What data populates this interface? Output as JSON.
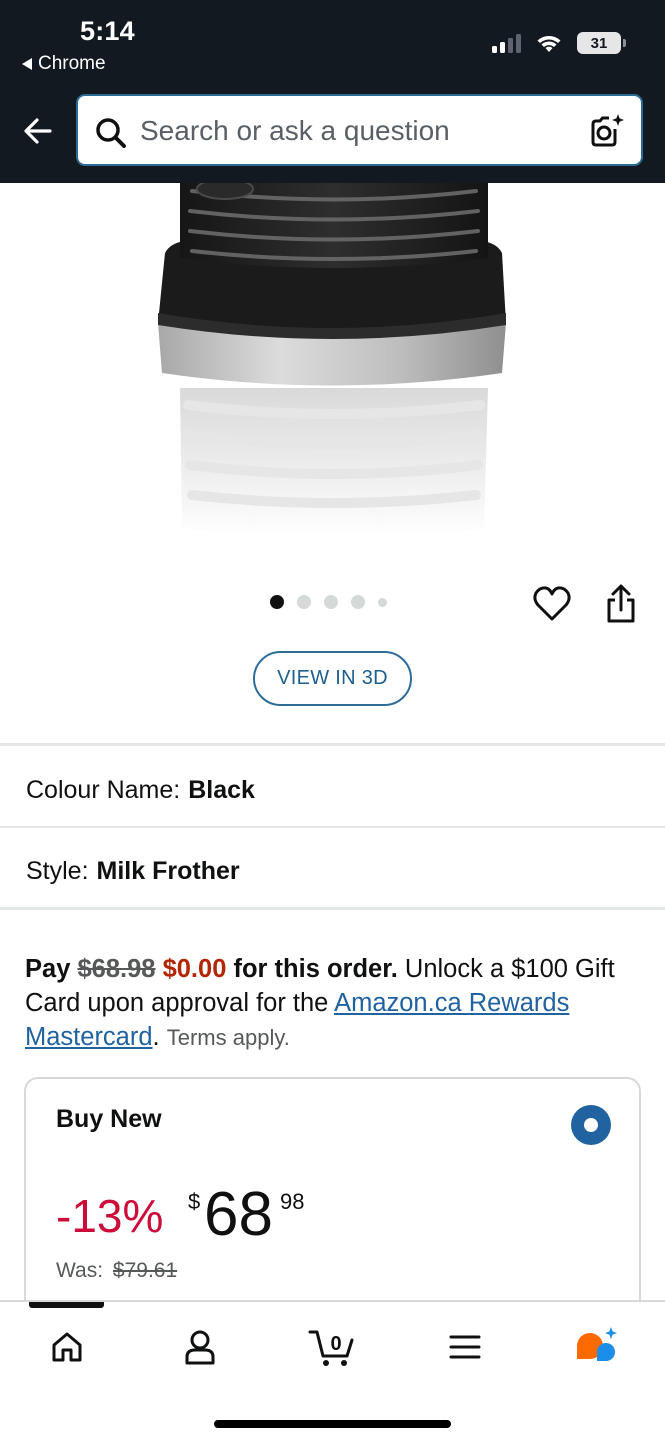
{
  "status_bar": {
    "time": "5:14",
    "back_app": "Chrome",
    "battery": "31"
  },
  "search": {
    "placeholder": "Search or ask a question"
  },
  "gallery": {
    "image_count": 5,
    "active_index": 0
  },
  "view_3d_label": "VIEW IN 3D",
  "colour": {
    "label": "Colour Name:",
    "value": "Black"
  },
  "style": {
    "label": "Style:",
    "value": "Milk Frother"
  },
  "offer": {
    "pay": "Pay",
    "old_price": "$68.98",
    "new_price": "$0.00",
    "for_order": "for this order.",
    "unlock_text": "Unlock a $100 Gift Card upon approval for the",
    "link_text": "Amazon.ca Rewards Mastercard",
    "period": ".",
    "terms": "Terms apply."
  },
  "buy_new": {
    "title": "Buy New",
    "discount": "-13%",
    "currency": "$",
    "price_whole": "68",
    "price_fraction": "98",
    "was_label": "Was:",
    "was_price": "$79.61"
  },
  "bottom_nav": {
    "cart_count": "0",
    "items": [
      "home-icon",
      "account-icon",
      "cart-icon",
      "menu-icon",
      "rufus-icon"
    ]
  },
  "colors": {
    "header_bg": "#131921",
    "link": "#2162a1",
    "deal_red": "#cc0c39",
    "price_red": "#b12704",
    "rufus_orange": "#ff6a00",
    "rufus_blue": "#1b8fe8"
  }
}
